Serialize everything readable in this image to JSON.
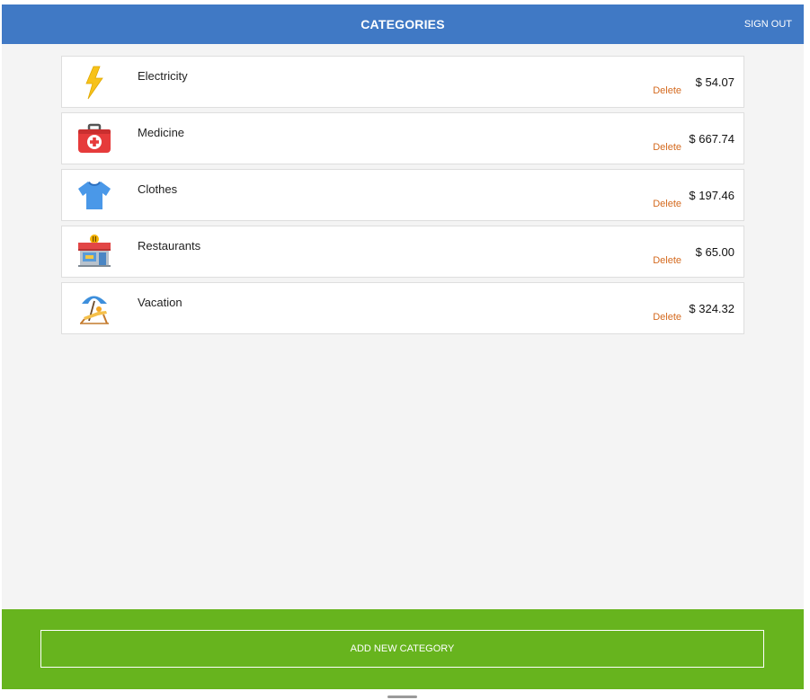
{
  "header": {
    "title": "CATEGORIES",
    "sign_out_label": "SIGN OUT"
  },
  "categories": [
    {
      "name": "Electricity",
      "icon": "lightning-bolt-icon",
      "delete_label": "Delete",
      "amount": "$ 54.07"
    },
    {
      "name": "Medicine",
      "icon": "first-aid-kit-icon",
      "delete_label": "Delete",
      "amount": "$ 667.74"
    },
    {
      "name": "Clothes",
      "icon": "t-shirt-icon",
      "delete_label": "Delete",
      "amount": "$ 197.46"
    },
    {
      "name": "Restaurants",
      "icon": "restaurant-store-icon",
      "delete_label": "Delete",
      "amount": "$ 65.00"
    },
    {
      "name": "Vacation",
      "icon": "beach-umbrella-icon",
      "delete_label": "Delete",
      "amount": "$ 324.32"
    }
  ],
  "footer": {
    "add_button_label": "ADD NEW CATEGORY"
  },
  "colors": {
    "header": "#4079c5",
    "footer": "#67b41e",
    "delete_link": "#d46a1f",
    "background": "#f4f4f4"
  }
}
